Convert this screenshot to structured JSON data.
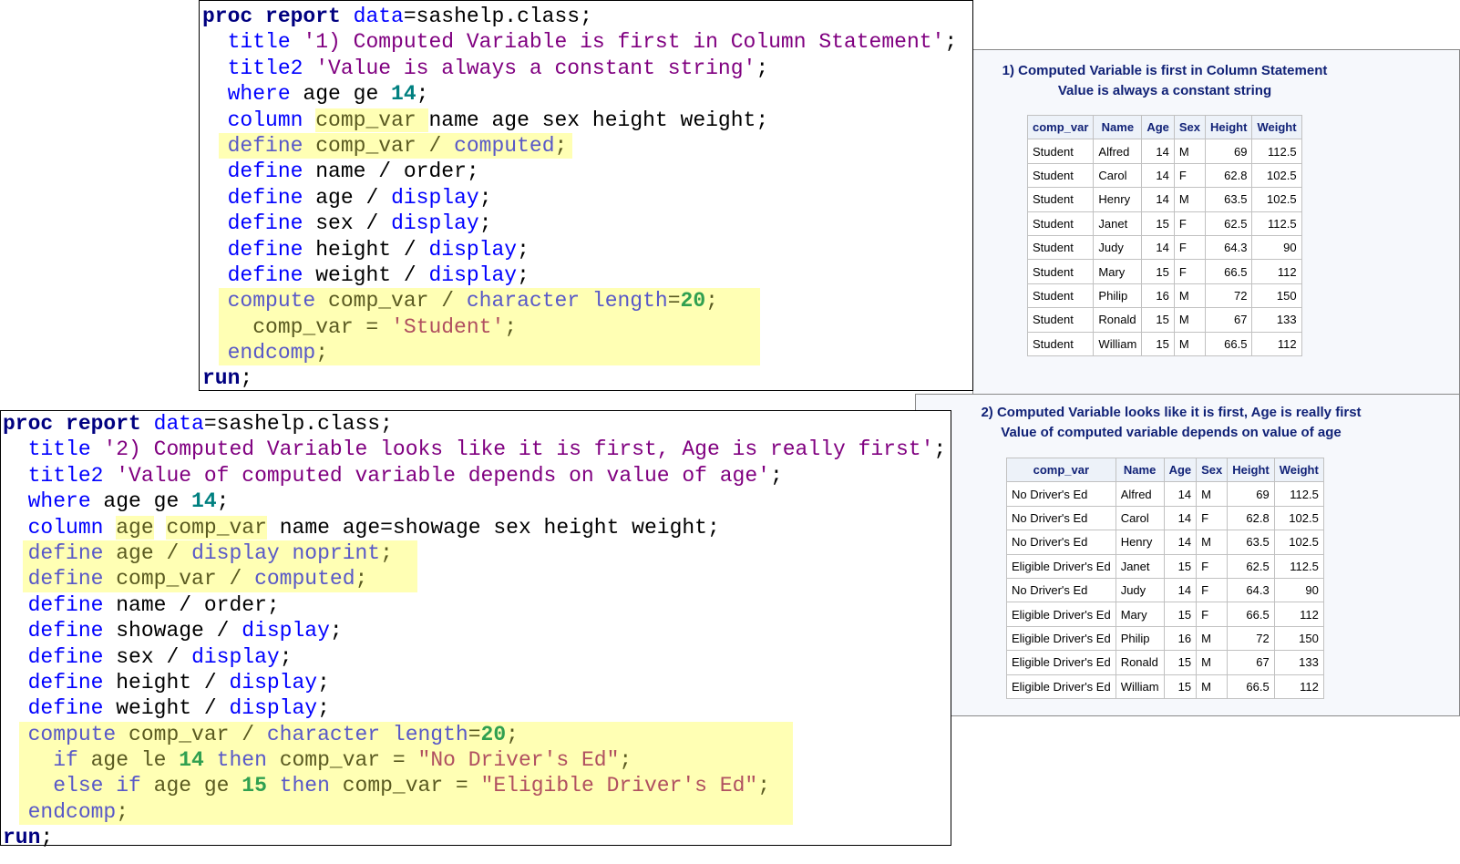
{
  "code_blocks": [
    {
      "lines": [
        {
          "tokens": [
            {
              "t": "proc report",
              "c": "bold"
            },
            {
              "t": " "
            },
            {
              "t": "data",
              "c": "kw"
            },
            {
              "t": "=sashelp.class;"
            }
          ]
        },
        {
          "tokens": [
            {
              "t": "  "
            },
            {
              "t": "title",
              "c": "kw"
            },
            {
              "t": " "
            },
            {
              "t": "'1) Computed Variable is first in Column Statement'",
              "c": "str"
            },
            {
              "t": ";"
            }
          ]
        },
        {
          "tokens": [
            {
              "t": "  "
            },
            {
              "t": "title2",
              "c": "kw"
            },
            {
              "t": " "
            },
            {
              "t": "'Value is always a constant string'",
              "c": "str"
            },
            {
              "t": ";"
            }
          ]
        },
        {
          "tokens": [
            {
              "t": "  "
            },
            {
              "t": "where",
              "c": "kw"
            },
            {
              "t": " age ge "
            },
            {
              "t": "14",
              "c": "num"
            },
            {
              "t": ";"
            }
          ]
        },
        {
          "tokens": [
            {
              "t": "  "
            },
            {
              "t": "column",
              "c": "kw"
            },
            {
              "t": " "
            },
            {
              "t": "comp_var ",
              "h": true
            },
            {
              "t": "name age sex height weight;"
            }
          ]
        },
        {
          "block": "a",
          "tokens": [
            {
              "t": "  "
            },
            {
              "t": "define",
              "c": "kw"
            },
            {
              "t": " comp_var / "
            },
            {
              "t": "computed",
              "c": "kw"
            },
            {
              "t": ";"
            }
          ]
        },
        {
          "tokens": [
            {
              "t": "  "
            },
            {
              "t": "define",
              "c": "kw"
            },
            {
              "t": " name / order;"
            }
          ]
        },
        {
          "tokens": [
            {
              "t": "  "
            },
            {
              "t": "define",
              "c": "kw"
            },
            {
              "t": " age / "
            },
            {
              "t": "display",
              "c": "kw"
            },
            {
              "t": ";"
            }
          ]
        },
        {
          "tokens": [
            {
              "t": "  "
            },
            {
              "t": "define",
              "c": "kw"
            },
            {
              "t": " sex / "
            },
            {
              "t": "display",
              "c": "kw"
            },
            {
              "t": ";"
            }
          ]
        },
        {
          "tokens": [
            {
              "t": "  "
            },
            {
              "t": "define",
              "c": "kw"
            },
            {
              "t": " height / "
            },
            {
              "t": "display",
              "c": "kw"
            },
            {
              "t": ";"
            }
          ]
        },
        {
          "tokens": [
            {
              "t": "  "
            },
            {
              "t": "define",
              "c": "kw"
            },
            {
              "t": " weight / "
            },
            {
              "t": "display",
              "c": "kw"
            },
            {
              "t": ";"
            }
          ]
        },
        {
          "block": "b",
          "tokens": [
            {
              "t": "  "
            },
            {
              "t": "compute",
              "c": "kw"
            },
            {
              "t": " comp_var / "
            },
            {
              "t": "character length",
              "c": "kw"
            },
            {
              "t": "="
            },
            {
              "t": "20",
              "c": "num"
            },
            {
              "t": ";"
            }
          ]
        },
        {
          "block": "b",
          "tokens": [
            {
              "t": "    comp_var = "
            },
            {
              "t": "'Student'",
              "c": "str"
            },
            {
              "t": ";"
            }
          ]
        },
        {
          "block": "b",
          "tokens": [
            {
              "t": "  "
            },
            {
              "t": "endcomp",
              "c": "kw"
            },
            {
              "t": ";"
            }
          ]
        },
        {
          "tokens": [
            {
              "t": "run",
              "c": "bold"
            },
            {
              "t": ";"
            }
          ]
        }
      ]
    },
    {
      "lines": [
        {
          "tokens": [
            {
              "t": "proc report",
              "c": "bold"
            },
            {
              "t": " "
            },
            {
              "t": "data",
              "c": "kw"
            },
            {
              "t": "=sashelp.class;"
            }
          ]
        },
        {
          "tokens": [
            {
              "t": "  "
            },
            {
              "t": "title",
              "c": "kw"
            },
            {
              "t": " "
            },
            {
              "t": "'2) Computed Variable looks like it is first, Age is really first'",
              "c": "str"
            },
            {
              "t": ";"
            }
          ]
        },
        {
          "tokens": [
            {
              "t": "  "
            },
            {
              "t": "title2",
              "c": "kw"
            },
            {
              "t": " "
            },
            {
              "t": "'Value of computed variable depends on value of age'",
              "c": "str"
            },
            {
              "t": ";"
            }
          ]
        },
        {
          "tokens": [
            {
              "t": "  "
            },
            {
              "t": "where",
              "c": "kw"
            },
            {
              "t": " age ge "
            },
            {
              "t": "14",
              "c": "num"
            },
            {
              "t": ";"
            }
          ]
        },
        {
          "tokens": [
            {
              "t": "  "
            },
            {
              "t": "column",
              "c": "kw"
            },
            {
              "t": " "
            },
            {
              "t": "age",
              "h": true
            },
            {
              "t": " "
            },
            {
              "t": "comp_var",
              "h": true
            },
            {
              "t": " name age=showage sex height weight;"
            }
          ]
        },
        {
          "block": "a",
          "tokens": [
            {
              "t": "  "
            },
            {
              "t": "define",
              "c": "kw"
            },
            {
              "t": " age / "
            },
            {
              "t": "display noprint",
              "c": "kw"
            },
            {
              "t": ";"
            }
          ]
        },
        {
          "block": "a",
          "tokens": [
            {
              "t": "  "
            },
            {
              "t": "define",
              "c": "kw"
            },
            {
              "t": " comp_var / "
            },
            {
              "t": "computed",
              "c": "kw"
            },
            {
              "t": ";"
            }
          ]
        },
        {
          "tokens": [
            {
              "t": "  "
            },
            {
              "t": "define",
              "c": "kw"
            },
            {
              "t": " name / order;"
            }
          ]
        },
        {
          "tokens": [
            {
              "t": "  "
            },
            {
              "t": "define",
              "c": "kw"
            },
            {
              "t": " showage / "
            },
            {
              "t": "display",
              "c": "kw"
            },
            {
              "t": ";"
            }
          ]
        },
        {
          "tokens": [
            {
              "t": "  "
            },
            {
              "t": "define",
              "c": "kw"
            },
            {
              "t": " sex / "
            },
            {
              "t": "display",
              "c": "kw"
            },
            {
              "t": ";"
            }
          ]
        },
        {
          "tokens": [
            {
              "t": "  "
            },
            {
              "t": "define",
              "c": "kw"
            },
            {
              "t": " height / "
            },
            {
              "t": "display",
              "c": "kw"
            },
            {
              "t": ";"
            }
          ]
        },
        {
          "tokens": [
            {
              "t": "  "
            },
            {
              "t": "define",
              "c": "kw"
            },
            {
              "t": " weight / "
            },
            {
              "t": "display",
              "c": "kw"
            },
            {
              "t": ";"
            }
          ]
        },
        {
          "block": "b",
          "tokens": [
            {
              "t": "  "
            },
            {
              "t": "compute",
              "c": "kw"
            },
            {
              "t": " comp_var / "
            },
            {
              "t": "character length",
              "c": "kw"
            },
            {
              "t": "="
            },
            {
              "t": "20",
              "c": "num"
            },
            {
              "t": ";"
            }
          ]
        },
        {
          "block": "b",
          "tokens": [
            {
              "t": "    "
            },
            {
              "t": "if",
              "c": "kw"
            },
            {
              "t": " age le "
            },
            {
              "t": "14",
              "c": "num"
            },
            {
              "t": " "
            },
            {
              "t": "then",
              "c": "kw"
            },
            {
              "t": " comp_var = "
            },
            {
              "t": "\"No Driver's Ed\"",
              "c": "str"
            },
            {
              "t": ";"
            }
          ]
        },
        {
          "block": "b",
          "tokens": [
            {
              "t": "    "
            },
            {
              "t": "else if",
              "c": "kw"
            },
            {
              "t": " age ge "
            },
            {
              "t": "15",
              "c": "num"
            },
            {
              "t": " "
            },
            {
              "t": "then",
              "c": "kw"
            },
            {
              "t": " comp_var = "
            },
            {
              "t": "\"Eligible Driver's Ed\"",
              "c": "str"
            },
            {
              "t": ";"
            }
          ]
        },
        {
          "block": "b",
          "tokens": [
            {
              "t": "  "
            },
            {
              "t": "endcomp",
              "c": "kw"
            },
            {
              "t": ";"
            }
          ]
        },
        {
          "tokens": [
            {
              "t": "run",
              "c": "bold"
            },
            {
              "t": ";"
            }
          ]
        }
      ]
    }
  ],
  "reports": [
    {
      "title": "1) Computed Variable is first in Column Statement",
      "title2": "Value is always a constant string",
      "columns": [
        "comp_var",
        "Name",
        "Age",
        "Sex",
        "Height",
        "Weight"
      ],
      "rows": [
        [
          "Student",
          "Alfred",
          "14",
          "M",
          "69",
          "112.5"
        ],
        [
          "Student",
          "Carol",
          "14",
          "F",
          "62.8",
          "102.5"
        ],
        [
          "Student",
          "Henry",
          "14",
          "M",
          "63.5",
          "102.5"
        ],
        [
          "Student",
          "Janet",
          "15",
          "F",
          "62.5",
          "112.5"
        ],
        [
          "Student",
          "Judy",
          "14",
          "F",
          "64.3",
          "90"
        ],
        [
          "Student",
          "Mary",
          "15",
          "F",
          "66.5",
          "112"
        ],
        [
          "Student",
          "Philip",
          "16",
          "M",
          "72",
          "150"
        ],
        [
          "Student",
          "Ronald",
          "15",
          "M",
          "67",
          "133"
        ],
        [
          "Student",
          "William",
          "15",
          "M",
          "66.5",
          "112"
        ]
      ]
    },
    {
      "title": "2) Computed Variable looks like it is first, Age is really first",
      "title2": "Value of computed variable depends on value of age",
      "columns": [
        "comp_var",
        "Name",
        "Age",
        "Sex",
        "Height",
        "Weight"
      ],
      "rows": [
        [
          "No Driver's Ed",
          "Alfred",
          "14",
          "M",
          "69",
          "112.5"
        ],
        [
          "No Driver's Ed",
          "Carol",
          "14",
          "F",
          "62.8",
          "102.5"
        ],
        [
          "No Driver's Ed",
          "Henry",
          "14",
          "M",
          "63.5",
          "102.5"
        ],
        [
          "Eligible Driver's Ed",
          "Janet",
          "15",
          "F",
          "62.5",
          "112.5"
        ],
        [
          "No Driver's Ed",
          "Judy",
          "14",
          "F",
          "64.3",
          "90"
        ],
        [
          "Eligible Driver's Ed",
          "Mary",
          "15",
          "F",
          "66.5",
          "112"
        ],
        [
          "Eligible Driver's Ed",
          "Philip",
          "16",
          "M",
          "72",
          "150"
        ],
        [
          "Eligible Driver's Ed",
          "Ronald",
          "15",
          "M",
          "67",
          "133"
        ],
        [
          "Eligible Driver's Ed",
          "William",
          "15",
          "M",
          "66.5",
          "112"
        ]
      ]
    }
  ]
}
